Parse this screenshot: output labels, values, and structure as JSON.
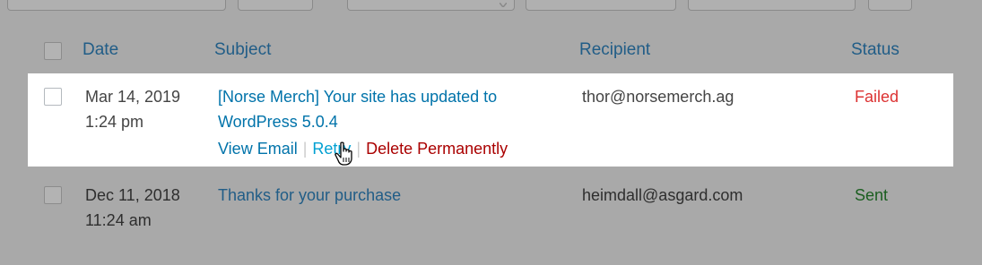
{
  "table": {
    "columns": {
      "date": "Date",
      "subject": "Subject",
      "recipient": "Recipient",
      "status": "Status"
    },
    "rows": [
      {
        "date": "Mar 14, 2019",
        "time": "1:24 pm",
        "subject_line1": "[Norse Merch] Your site has updated to",
        "subject_line2": "WordPress 5.0.4",
        "recipient": "thor@norsemerch.ag",
        "status": "Failed",
        "actions": {
          "view": "View Email",
          "retry": "Retry",
          "delete": "Delete Permanently"
        }
      },
      {
        "date": "Dec 11, 2018",
        "time": "11:24 am",
        "subject_line1": "Thanks for your purchase",
        "recipient": "heimdall@asgard.com",
        "status": "Sent"
      }
    ]
  },
  "colors": {
    "link": "#0073aa",
    "failed": "#dc3232",
    "sent": "#1b5e20",
    "delete": "#aa0000",
    "overlay": "#a9a9a9"
  },
  "icons": {
    "cursor": "hand-pointer-icon"
  }
}
